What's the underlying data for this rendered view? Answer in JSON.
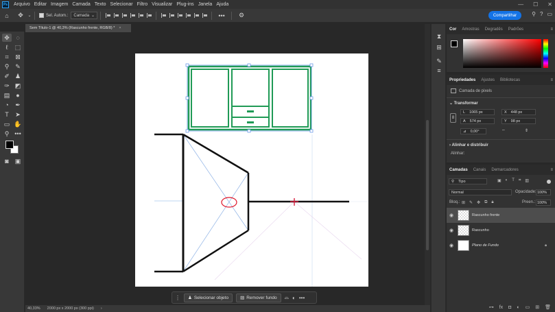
{
  "menu": {
    "items": [
      "Arquivo",
      "Editar",
      "Imagem",
      "Camada",
      "Texto",
      "Selecionar",
      "Filtro",
      "Visualizar",
      "Plug-ins",
      "Janela",
      "Ajuda"
    ]
  },
  "options": {
    "auto_select_label": "Sel. Autom.:",
    "auto_select_value": "Camada",
    "share_label": "Compartilhar"
  },
  "document": {
    "tab_title": "Sem Título-1 @ 40,3% (Rascunho frente, RGB/8) *"
  },
  "status": {
    "zoom": "40,33%",
    "doc_info": "2000 px x 2000 px (300 ppi)"
  },
  "context_bar": {
    "select_subject": "Selecionar objeto",
    "remove_bg": "Remover fundo"
  },
  "color_panel": {
    "tabs": [
      "Cor",
      "Amostras",
      "Degradês",
      "Padrões"
    ],
    "foreground": "#000000",
    "background": "#ffffff"
  },
  "properties_panel": {
    "tabs": [
      "Propriedades",
      "Ajustes",
      "Bibliotecas"
    ],
    "layer_type": "Camada de pixels",
    "transform_title": "Transformar",
    "L": "1065 px",
    "X": "448 px",
    "A": "574 px",
    "Y": "98 px",
    "angle": "0,00°",
    "align_title": "Alinhar e distribuir",
    "align_label": "Alinhar:"
  },
  "layers_panel": {
    "tabs": [
      "Camadas",
      "Canais",
      "Demarcadores"
    ],
    "filter_label": "Tipo",
    "blend_mode": "Normal",
    "opacity_label": "Opacidade:",
    "opacity_value": "100%",
    "lock_label": "Bloq.:",
    "fill_label": "Preen.:",
    "fill_value": "100%",
    "layers": [
      {
        "name": "Rascunho frente",
        "selected": true
      },
      {
        "name": "Rascunho",
        "selected": false
      },
      {
        "name": "Plano de Fundo",
        "selected": false
      }
    ]
  }
}
